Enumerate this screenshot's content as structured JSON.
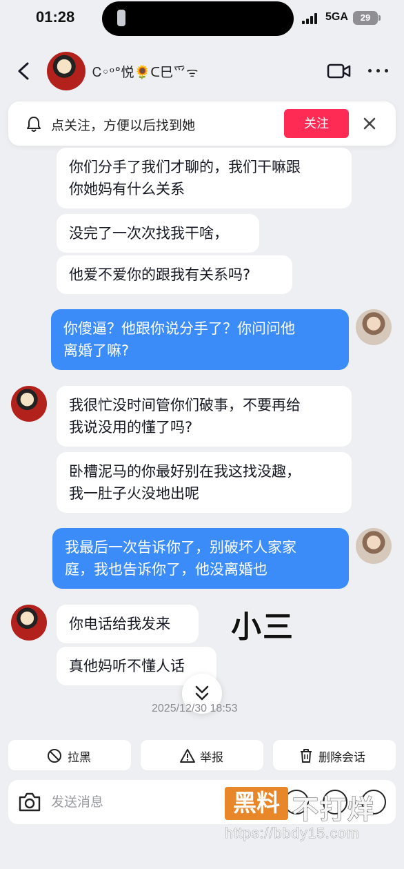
{
  "status_bar": {
    "time": "01:28",
    "network": "5GA",
    "battery": "29"
  },
  "header": {
    "contact_name": "Ꮯ◦ᵒ°悦🌻ᑕ巳⺤ᯤ",
    "icons": [
      "back-icon",
      "video-call-icon",
      "more-icon"
    ]
  },
  "follow_banner": {
    "text": "点关注，方便以后找到她",
    "button_label": "关注",
    "accent_color": "#fe2c55"
  },
  "messages": [
    {
      "sender": "other",
      "text": "你们分手了我们才聊的，我们干嘛跟\n你她妈有什么关系"
    },
    {
      "sender": "other",
      "text": "没完了一次次找我干啥，"
    },
    {
      "sender": "other",
      "text": "他爱不爱你的跟我有关系吗?"
    },
    {
      "sender": "me",
      "text": "你傻逼？他跟你说分手了？你问问他\n离婚了嘛?"
    },
    {
      "sender": "other",
      "text": "我很忙没时间管你们破事，不要再给\n我说没用的懂了吗?"
    },
    {
      "sender": "other",
      "text": "卧槽泥马的你最好别在我这找没趣，\n我一肚子火没地出呢"
    },
    {
      "sender": "me",
      "text": "我最后一次告诉你了，别破坏人家家\n庭，我也告诉你了，他没离婚也"
    },
    {
      "sender": "other",
      "text": "你电话给我发来"
    },
    {
      "sender": "other",
      "text": "真他妈听不懂人话"
    }
  ],
  "overlay_label": "小三",
  "timestamp": "2025/12/30 18:53",
  "actions": [
    {
      "label": "拉黑",
      "icon": "block-icon"
    },
    {
      "label": "举报",
      "icon": "warning-icon"
    },
    {
      "label": "删除会话",
      "icon": "trash-icon"
    }
  ],
  "composer": {
    "placeholder": "发送消息"
  },
  "watermark": {
    "badge": "黑料",
    "text": "不打烊",
    "url": "https://bbdy15.com"
  },
  "colors": {
    "outgoing_bubble": "#3b8cf8",
    "incoming_bubble": "#ffffff",
    "background": "#eeeff2"
  }
}
